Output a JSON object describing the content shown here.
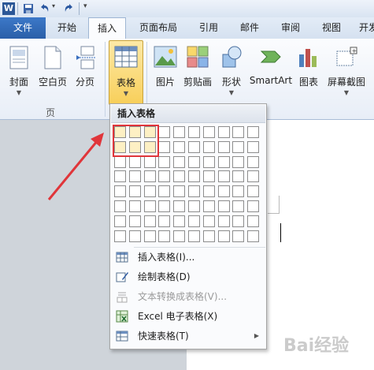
{
  "qat": {
    "app_letter": "W"
  },
  "tabs": [
    {
      "label": "文件",
      "type": "file"
    },
    {
      "label": "开始"
    },
    {
      "label": "插入",
      "active": true
    },
    {
      "label": "页面布局"
    },
    {
      "label": "引用"
    },
    {
      "label": "邮件"
    },
    {
      "label": "审阅"
    },
    {
      "label": "视图"
    },
    {
      "label": "开发"
    }
  ],
  "ribbon": {
    "cover": "封面",
    "blank_page": "空白页",
    "page_break": "分页",
    "group_pages": "页",
    "table": "表格",
    "picture": "图片",
    "clipart": "剪贴画",
    "shapes": "形状",
    "smartart": "SmartArt",
    "chart": "图表",
    "screenshot": "屏幕截图"
  },
  "menu": {
    "header": "插入表格",
    "grid_cols": 10,
    "grid_rows": 8,
    "highlighted_cols": 3,
    "highlighted_rows": 2,
    "items": [
      {
        "label": "插入表格(I)...",
        "icon": "insert-table-icon",
        "enabled": true
      },
      {
        "label": "绘制表格(D)",
        "icon": "draw-table-icon",
        "enabled": true
      },
      {
        "label": "文本转换成表格(V)...",
        "icon": "text-to-table-icon",
        "enabled": false
      },
      {
        "label": "Excel 电子表格(X)",
        "icon": "excel-icon",
        "enabled": true
      },
      {
        "label": "快速表格(T)",
        "icon": "quick-table-icon",
        "enabled": true,
        "submenu": true
      }
    ]
  },
  "watermark": "Bai经验"
}
